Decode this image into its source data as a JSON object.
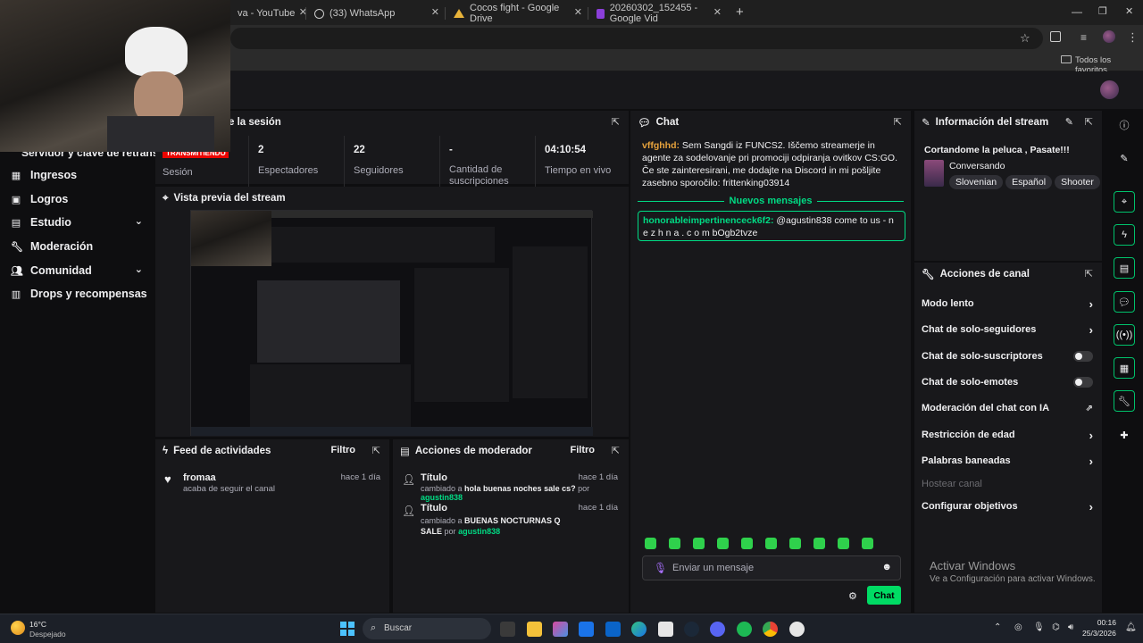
{
  "browser": {
    "tabs": [
      {
        "label": "va - YouTube",
        "icon": "youtube-icon"
      },
      {
        "label": "(33) WhatsApp",
        "icon": "whatsapp-icon"
      },
      {
        "label": "Cocos fight - Google Drive",
        "icon": "drive-icon"
      },
      {
        "label": "20260302_152455 - Google Vid",
        "icon": "video-icon"
      }
    ],
    "new_tab": "+",
    "bookmarks_label": "Todos los favoritos"
  },
  "nav": {
    "overlay_top": "Servidor y clave de retransi",
    "items": [
      {
        "label": "Ingresos",
        "icon": "ingresos-icon",
        "chevron": false
      },
      {
        "label": "Logros",
        "icon": "logros-icon",
        "chevron": false
      },
      {
        "label": "Estudio",
        "icon": "estudio-icon",
        "chevron": true
      },
      {
        "label": "Moderación",
        "icon": "wrench-icon",
        "chevron": false
      },
      {
        "label": "Comunidad",
        "icon": "people-icon",
        "chevron": true
      },
      {
        "label": "Drops y recompensas",
        "icon": "drops-icon",
        "chevron": false
      }
    ]
  },
  "session": {
    "title_partial": "e la sesión",
    "live_badge": "TRANSMITIENDO",
    "session_label": "Sesión",
    "stats": [
      {
        "value": "2",
        "label": "Espectadores"
      },
      {
        "value": "22",
        "label": "Seguidores"
      },
      {
        "value": "-",
        "label": "Cantidad de suscripciones"
      },
      {
        "value": "04:10:54",
        "label": "Tiempo en vivo"
      }
    ]
  },
  "preview": {
    "title": "Vista previa del stream"
  },
  "feed": {
    "title": "Feed de actividades",
    "filter": "Filtro",
    "items": [
      {
        "user": "fromaa",
        "text": "acaba de seguir el canal",
        "time": "hace 1 día"
      }
    ]
  },
  "modactions": {
    "title": "Acciones de moderador",
    "filter": "Filtro",
    "items": [
      {
        "title": "Título",
        "prefix": "cambiado a",
        "value": "hola buenas noches sale cs?",
        "by": "por",
        "user": "agustin838",
        "time": "hace 1 día"
      },
      {
        "title": "Título",
        "prefix": "cambiado a",
        "value": "BUENAS NOCTURNAS Q SALE",
        "by": "por",
        "user": "agustin838",
        "time": "hace 1 día"
      }
    ]
  },
  "chat": {
    "title": "Chat",
    "msg1_user": "vffghhd:",
    "msg1_text": " Sem Sangdi iz FUNCS2. Iščemo streamerje in agente za sodelovanje pri promociji odpiranja ovitkov CS:GO. Če ste zainteresirani, me dodajte na Discord in mi pošljite zasebno sporočilo: frittenking03914",
    "new_messages": "Nuevos mensajes",
    "msg2_user": "honorableimpertinenceck6f2:",
    "msg2_text": " @agustin838 come to us - n e z h n a . c o m bOgb2tvze",
    "input_placeholder": "Enviar un mensaje",
    "send_label": "Chat",
    "emote_count": 10
  },
  "streaminfo": {
    "title": "Información del stream",
    "stream_title": "Cortandome la peluca , Pasate!!!",
    "category": "Conversando",
    "tags": [
      "Slovenian",
      "Español",
      "Shooter"
    ]
  },
  "channel_actions": {
    "title": "Acciones de canal",
    "items": [
      {
        "label": "Modo lento",
        "control": "chevron"
      },
      {
        "label": "Chat de solo-seguidores",
        "control": "chevron"
      },
      {
        "label": "Chat de solo-suscriptores",
        "control": "toggle"
      },
      {
        "label": "Chat de solo-emotes",
        "control": "toggle"
      },
      {
        "label": "Moderación del chat con IA",
        "control": "external"
      },
      {
        "label": "Restricción de edad",
        "control": "chevron"
      },
      {
        "label": "Palabras baneadas",
        "control": "chevron"
      },
      {
        "label": "Hostear canal",
        "control": "disabled"
      },
      {
        "label": "Configurar objetivos",
        "control": "chevron"
      }
    ]
  },
  "watermark": {
    "title": "Activar Windows",
    "subtitle": "Ve a Configuración para activar Windows."
  },
  "taskbar": {
    "temp": "16°C",
    "weather": "Despejado",
    "search": "Buscar",
    "time": "00:16",
    "date": "25/3/2026"
  }
}
